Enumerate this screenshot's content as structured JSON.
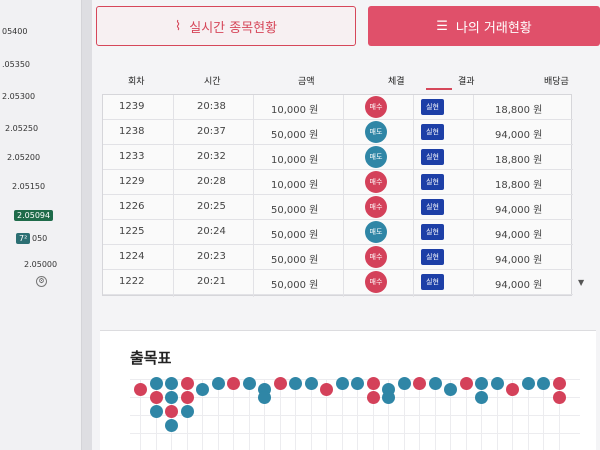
{
  "price_axis": {
    "ticks": [
      "05400",
      ".05350",
      "2.05300",
      "2.05250",
      "2.05200",
      "2.05150",
      "050",
      "2.05000"
    ],
    "badge_main": "2.05094",
    "badge_small": "7²"
  },
  "tabs": {
    "realtime_label": "실시간 종목현황",
    "my_trades_label": "나의 거래현황"
  },
  "table": {
    "headers": [
      "회차",
      "시간",
      "금액",
      "체결",
      "결과",
      "배당금"
    ],
    "rows": [
      {
        "round": "1239",
        "time": "20:38",
        "amount": "10,000 원",
        "side": "매수",
        "result": "실현",
        "payout": "18,800 원"
      },
      {
        "round": "1238",
        "time": "20:37",
        "amount": "50,000 원",
        "side": "매도",
        "result": "실현",
        "payout": "94,000 원"
      },
      {
        "round": "1233",
        "time": "20:32",
        "amount": "10,000 원",
        "side": "매도",
        "result": "실현",
        "payout": "18,800 원"
      },
      {
        "round": "1229",
        "time": "20:28",
        "amount": "10,000 원",
        "side": "매수",
        "result": "실현",
        "payout": "18,800 원"
      },
      {
        "round": "1226",
        "time": "20:25",
        "amount": "50,000 원",
        "side": "매수",
        "result": "실현",
        "payout": "94,000 원"
      },
      {
        "round": "1225",
        "time": "20:24",
        "amount": "50,000 원",
        "side": "매도",
        "result": "실현",
        "payout": "94,000 원"
      },
      {
        "round": "1224",
        "time": "20:23",
        "amount": "50,000 원",
        "side": "매수",
        "result": "실현",
        "payout": "94,000 원"
      },
      {
        "round": "1222",
        "time": "20:21",
        "amount": "50,000 원",
        "side": "매수",
        "result": "실현",
        "payout": "94,000 원"
      }
    ]
  },
  "bottom": {
    "title": "출목표"
  },
  "colors": {
    "buy": "#d4415a",
    "sell": "#2f86a6",
    "status": "#1d3fa7",
    "accent": "#e0506a"
  }
}
